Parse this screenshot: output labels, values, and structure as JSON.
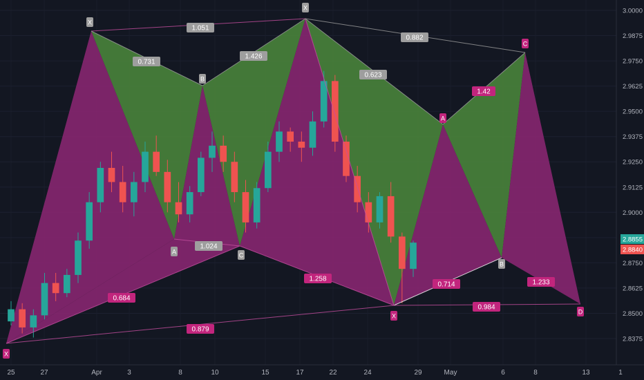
{
  "chart_data": {
    "type": "candlestick-harmonic-patterns",
    "y_axis": {
      "ticks": [
        "3.0000",
        "2.9875",
        "2.9750",
        "2.9625",
        "2.9500",
        "2.9375",
        "2.9250",
        "2.9125",
        "2.9000",
        "2.8875",
        "2.8750",
        "2.8625",
        "2.8500",
        "2.8375"
      ],
      "range": [
        2.8313,
        3.001
      ]
    },
    "x_axis": {
      "ticks": [
        "25",
        "27",
        "Apr",
        "3",
        "8",
        "10",
        "15",
        "17",
        "22",
        "24",
        "29",
        "May",
        "6",
        "8",
        "13",
        "1"
      ]
    },
    "price_badges": [
      {
        "value": "2.8855",
        "color": "#26a69a"
      },
      {
        "value": "2.8840",
        "color": "#ef5350"
      }
    ],
    "colors": {
      "background": "#131722",
      "up": "#26a69a",
      "down": "#ef5350",
      "bullish_fill": "#8e2774",
      "bearish_fill": "#4c8a3c",
      "pink_label": "#c2257d",
      "grey_label": "#9e9e9e"
    },
    "candles_note": "OHLC series, daily, Mar 24 to Apr 28",
    "candles": [
      [
        2.846,
        2.856,
        2.844,
        2.852
      ],
      [
        2.852,
        2.855,
        2.84,
        2.843
      ],
      [
        2.843,
        2.852,
        2.838,
        2.849
      ],
      [
        2.849,
        2.87,
        2.847,
        2.865
      ],
      [
        2.865,
        2.87,
        2.856,
        2.86
      ],
      [
        2.86,
        2.872,
        2.858,
        2.869
      ],
      [
        2.869,
        2.89,
        2.865,
        2.886
      ],
      [
        2.886,
        2.91,
        2.882,
        2.905
      ],
      [
        2.905,
        2.925,
        2.9,
        2.922
      ],
      [
        2.922,
        2.93,
        2.91,
        2.915
      ],
      [
        2.915,
        2.923,
        2.9,
        2.905
      ],
      [
        2.905,
        2.92,
        2.898,
        2.915
      ],
      [
        2.915,
        2.935,
        2.91,
        2.93
      ],
      [
        2.93,
        2.938,
        2.918,
        2.92
      ],
      [
        2.92,
        2.926,
        2.9,
        2.905
      ],
      [
        2.905,
        2.915,
        2.895,
        2.899
      ],
      [
        2.899,
        2.913,
        2.895,
        2.91
      ],
      [
        2.91,
        2.93,
        2.908,
        2.927
      ],
      [
        2.927,
        2.94,
        2.92,
        2.933
      ],
      [
        2.933,
        2.938,
        2.92,
        2.925
      ],
      [
        2.925,
        2.93,
        2.905,
        2.91
      ],
      [
        2.91,
        2.916,
        2.89,
        2.895
      ],
      [
        2.895,
        2.915,
        2.892,
        2.912
      ],
      [
        2.912,
        2.935,
        2.91,
        2.93
      ],
      [
        2.93,
        2.945,
        2.925,
        2.94
      ],
      [
        2.94,
        2.942,
        2.93,
        2.935
      ],
      [
        2.935,
        2.94,
        2.925,
        2.932
      ],
      [
        2.932,
        2.95,
        2.928,
        2.945
      ],
      [
        2.945,
        2.97,
        2.942,
        2.965
      ],
      [
        2.965,
        2.968,
        2.93,
        2.935
      ],
      [
        2.935,
        2.938,
        2.915,
        2.918
      ],
      [
        2.918,
        2.923,
        2.9,
        2.905
      ],
      [
        2.905,
        2.91,
        2.89,
        2.895
      ],
      [
        2.895,
        2.91,
        2.892,
        2.908
      ],
      [
        2.908,
        2.915,
        2.885,
        2.888
      ],
      [
        2.888,
        2.89,
        2.855,
        2.872
      ],
      [
        2.872,
        2.886,
        2.868,
        2.885
      ]
    ],
    "patterns": [
      {
        "type": "bullish",
        "legs": [
          "X",
          "A",
          "B",
          "C",
          "D"
        ]
      },
      {
        "type": "bearish",
        "legs": [
          "X",
          "A",
          "B",
          "C"
        ]
      },
      {
        "type": "bullish",
        "legs": [
          "X",
          "A",
          "B",
          "C"
        ]
      },
      {
        "type": "bearish",
        "legs": [
          "X",
          "A",
          "B",
          "C"
        ]
      },
      {
        "type": "bullish",
        "legs": [
          "X",
          "A",
          "B",
          "C",
          "D"
        ]
      }
    ],
    "point_labels": [
      "X",
      "A",
      "B",
      "C",
      "D"
    ],
    "ratio_labels": [
      {
        "text": "1.051",
        "style": "grey"
      },
      {
        "text": "0.731",
        "style": "grey"
      },
      {
        "text": "1.426",
        "style": "grey"
      },
      {
        "text": "0.882",
        "style": "grey"
      },
      {
        "text": "0.623",
        "style": "grey"
      },
      {
        "text": "1.42",
        "style": "pink"
      },
      {
        "text": "1.024",
        "style": "grey"
      },
      {
        "text": "0.684",
        "style": "pink"
      },
      {
        "text": "1.258",
        "style": "pink"
      },
      {
        "text": "0.714",
        "style": "pink"
      },
      {
        "text": "1.233",
        "style": "pink"
      },
      {
        "text": "0.984",
        "style": "pink"
      },
      {
        "text": "0.879",
        "style": "pink"
      }
    ]
  }
}
